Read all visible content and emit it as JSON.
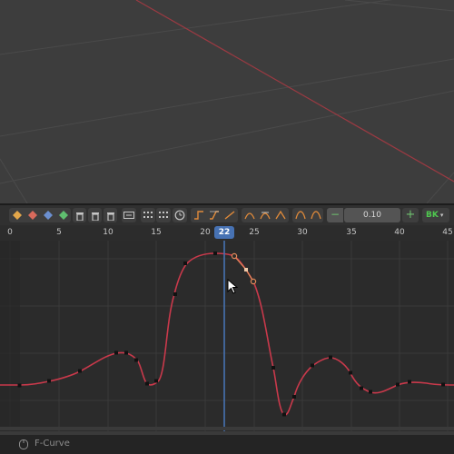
{
  "viewport": {
    "colors": {
      "background": "#3d3d3d",
      "grid": "#4a4a4a",
      "x_axis": "#9a3a42"
    }
  },
  "toolbar": {
    "icons": [
      "keyframe-orange-icon",
      "keyframe-red-icon",
      "keyframe-green-icon",
      "delete-keyframes-icon",
      "delete-keyframes-icon",
      "delete-channel-icon",
      "frame-all-icon",
      "snap-icon",
      "snap-alt-icon",
      "clock-icon",
      "constant-interp-icon",
      "linear-interp-icon",
      "bezier-interp-icon",
      "auto-handle-icon",
      "auto-clamped-icon",
      "vector-handle-icon",
      "ease-in-icon",
      "ease-out-icon"
    ],
    "frame_step": {
      "decrement_label": "−",
      "value": "0.10",
      "increment_label": "+"
    },
    "bk_dropdown_label": "BK"
  },
  "ruler": {
    "ticks": [
      "0",
      "5",
      "10",
      "15",
      "20",
      "25",
      "30",
      "35",
      "40",
      "45"
    ],
    "current_frame": "22"
  },
  "graph": {
    "colors": {
      "background": "#2b2b2b",
      "grid": "#393939",
      "curve": "#c9394b",
      "selected_keys": "#e48a5a",
      "playhead": "#4772b3"
    }
  },
  "status_bar": {
    "label": "F-Curve"
  }
}
